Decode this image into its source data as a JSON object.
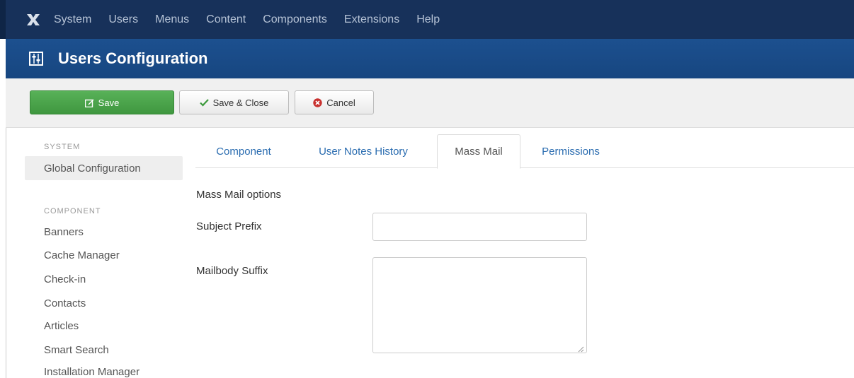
{
  "navbar": {
    "logo_icon": "joomla-icon",
    "items": [
      "System",
      "Users",
      "Menus",
      "Content",
      "Components",
      "Extensions",
      "Help"
    ]
  },
  "header": {
    "icon": "equalizer-icon",
    "title": "Users Configuration"
  },
  "toolbar": {
    "save_label": "Save",
    "save_close_label": "Save & Close",
    "cancel_label": "Cancel"
  },
  "sidebar": {
    "system_heading": "SYSTEM",
    "global_config": "Global Configuration",
    "component_heading": "COMPONENT",
    "items": [
      "Banners",
      "Cache Manager",
      "Check-in",
      "Contacts",
      "Articles",
      "Smart Search",
      "Installation Manager"
    ]
  },
  "tabs": [
    "Component",
    "User Notes History",
    "Mass Mail",
    "Permissions"
  ],
  "active_tab": "Mass Mail",
  "form": {
    "section_title": "Mass Mail options",
    "subject_prefix_label": "Subject Prefix",
    "subject_prefix_value": "",
    "mailbody_suffix_label": "Mailbody Suffix",
    "mailbody_suffix_value": ""
  },
  "colors": {
    "navbar_bg": "#17315a",
    "header_bg": "#1c508f",
    "save_button": "#46a546",
    "link": "#2a6cb0",
    "cancel_icon": "#c8312f"
  }
}
